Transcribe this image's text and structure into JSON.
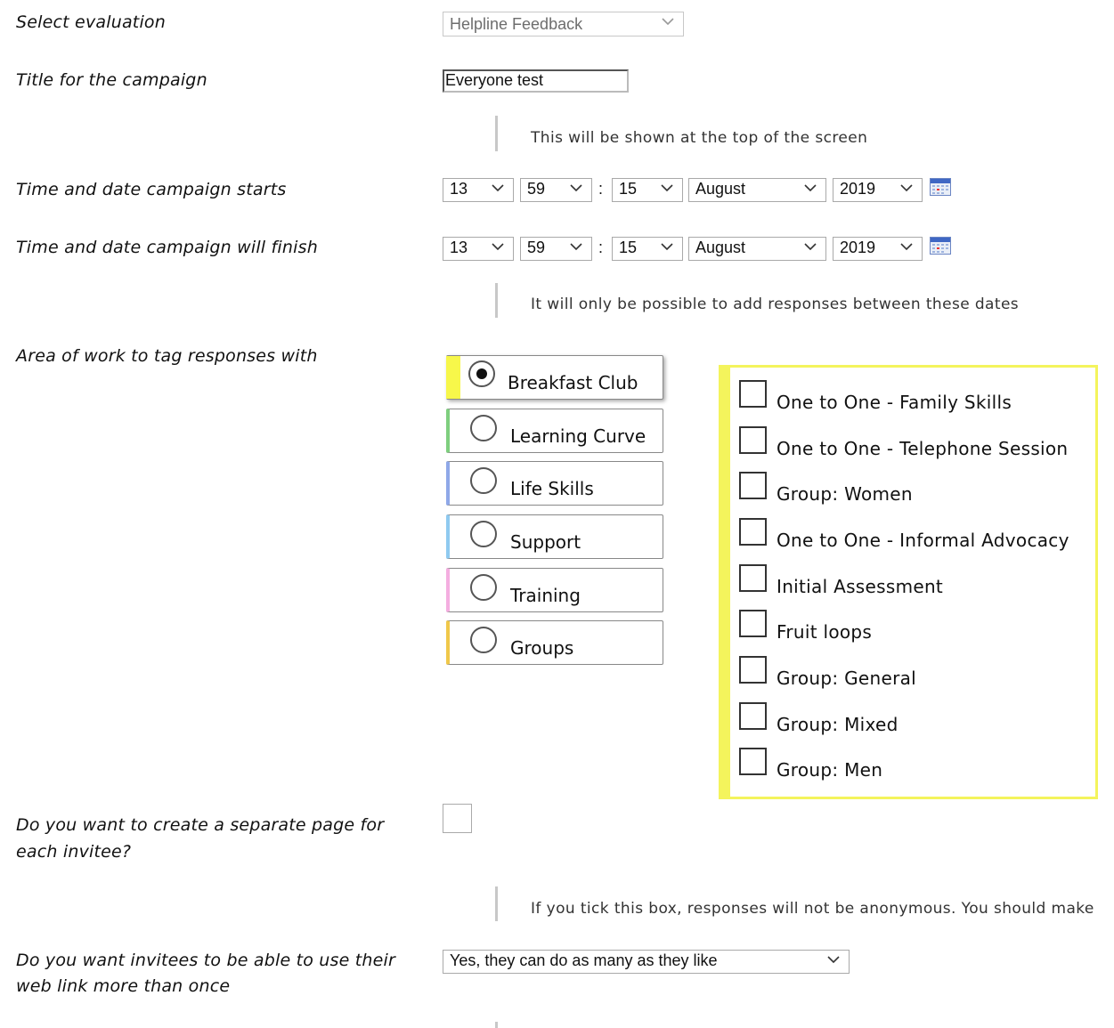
{
  "form": {
    "select_evaluation": {
      "label": "Select evaluation",
      "value": "Helpline Feedback"
    },
    "title": {
      "label": "Title for the campaign",
      "value": "Everyone test",
      "note": "This will be shown at the top of the screen"
    },
    "start": {
      "label": "Time and date campaign starts",
      "hour": "13",
      "minute": "59",
      "colon": ":",
      "day": "15",
      "month": "August",
      "year": "2019"
    },
    "finish": {
      "label": "Time and date campaign will finish",
      "hour": "13",
      "minute": "59",
      "colon": ":",
      "day": "15",
      "month": "August",
      "year": "2019",
      "note": "It will only be possible to add responses between these dates"
    },
    "area_of_work": {
      "label": "Area of work to tag responses with",
      "options": [
        {
          "label": "Breakfast Club",
          "selected": true,
          "color": "#f7f74a"
        },
        {
          "label": "Learning Curve",
          "selected": false,
          "color": "#7fcf7f"
        },
        {
          "label": "Life Skills",
          "selected": false,
          "color": "#8fa8e8"
        },
        {
          "label": "Support",
          "selected": false,
          "color": "#8fcaf0"
        },
        {
          "label": "Training",
          "selected": false,
          "color": "#f4aee0"
        },
        {
          "label": "Groups",
          "selected": false,
          "color": "#f0c84a"
        }
      ],
      "checkboxes": [
        {
          "label": "One to One - Family Skills",
          "checked": false
        },
        {
          "label": "One to One - Telephone Session",
          "checked": false
        },
        {
          "label": "Group: Women",
          "checked": false
        },
        {
          "label": "One to One - Informal Advocacy",
          "checked": false
        },
        {
          "label": "Initial Assessment",
          "checked": false
        },
        {
          "label": "Fruit loops",
          "checked": false
        },
        {
          "label": "Group: General",
          "checked": false
        },
        {
          "label": "Group: Mixed",
          "checked": false
        },
        {
          "label": "Group: Men",
          "checked": false
        }
      ]
    },
    "separate_page": {
      "label_line1": "Do you want to create a separate page for",
      "label_line2": "each invitee?",
      "checked": false,
      "note": "If you tick this box, responses will not be anonymous. You should make"
    },
    "reuse_link": {
      "label_line1": "Do you want invitees to be able to use their",
      "label_line2": "web link more than once",
      "value": "Yes, they can do as many as they like"
    }
  }
}
